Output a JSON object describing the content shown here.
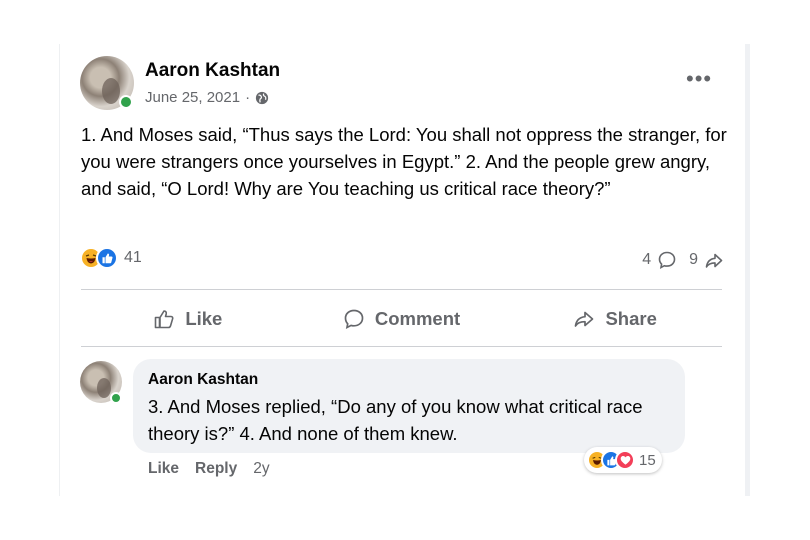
{
  "post": {
    "author": "Aaron Kashtan",
    "date": "June 25, 2021",
    "date_separator": "·",
    "audience_icon": "globe-icon",
    "more_label": "•••",
    "text": "1. And Moses said, “Thus says the Lord: You shall not oppress the stranger, for you were strangers once yourselves in Egypt.” 2. And the people grew angry, and said, “O Lord! Why are You teaching us critical race theory?”",
    "reactions": {
      "icons": [
        "haha",
        "like"
      ],
      "count": "41"
    },
    "comments_count": "4",
    "shares_count": "9"
  },
  "actions": {
    "like": "Like",
    "comment": "Comment",
    "share": "Share"
  },
  "comment": {
    "author": "Aaron Kashtan",
    "text": "3. And Moses replied, “Do any of you know what critical race theory is?” 4. And none of them knew.",
    "reactions": {
      "icons": [
        "haha",
        "like",
        "love"
      ],
      "count": "15"
    },
    "like_label": "Like",
    "reply_label": "Reply",
    "time": "2y"
  },
  "colors": {
    "like_blue": "#1b74e4",
    "haha_yellow": "#f7b125",
    "love_red": "#f33e58",
    "online_green": "#31a24c",
    "secondary_text": "#65676b"
  }
}
